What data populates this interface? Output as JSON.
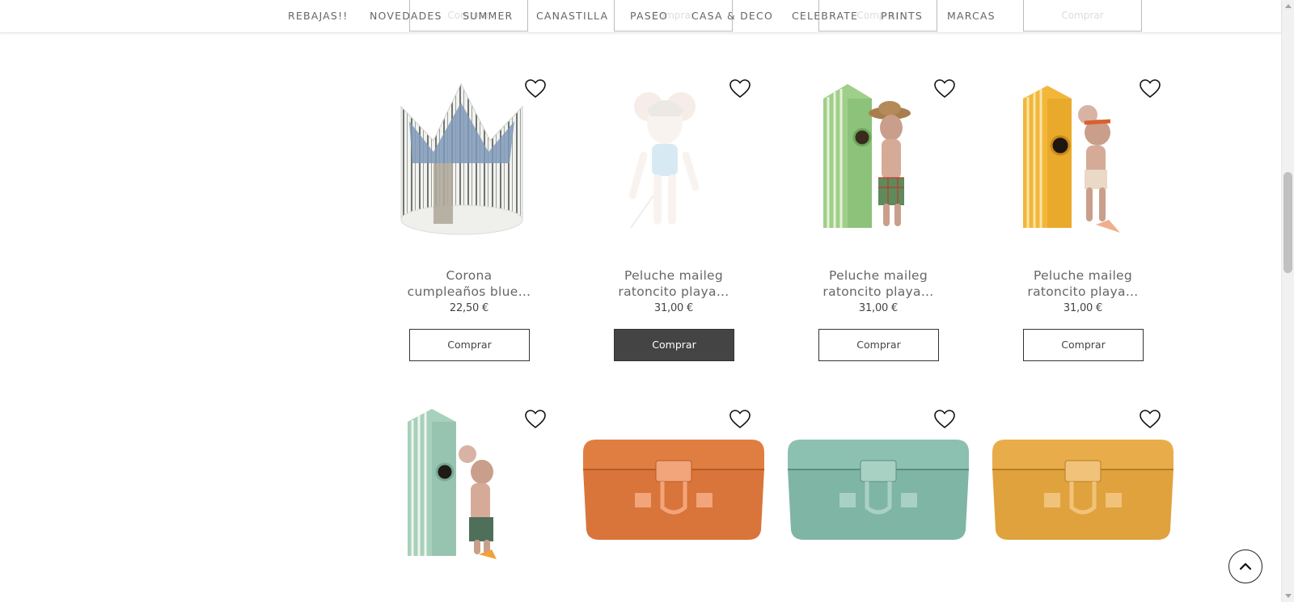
{
  "nav": {
    "items": [
      "REBAJAS!!",
      "NOVEDADES",
      "SUMMER",
      "CANASTILLA",
      "PASEO",
      "CASA & DECO",
      "CELEBRATE",
      "PRINTS",
      "MARCAS"
    ],
    "ghost_buttons": [
      "Comprar",
      "Comprar",
      "Comprar",
      "Comprar"
    ]
  },
  "products_row1": [
    {
      "name_line1": "Corona",
      "name_line2": "cumpleaños blue…",
      "price": "22,50 €",
      "buy_label": "Comprar"
    },
    {
      "name_line1": "Peluche maileg",
      "name_line2": "ratoncito playa…",
      "price": "31,00 €",
      "buy_label": "Comprar"
    },
    {
      "name_line1": "Peluche maileg",
      "name_line2": "ratoncito playa…",
      "price": "31,00 €",
      "buy_label": "Comprar"
    },
    {
      "name_line1": "Peluche maileg",
      "name_line2": "ratoncito playa…",
      "price": "31,00 €",
      "buy_label": "Comprar"
    }
  ],
  "colors": {
    "buy_hover_bg": "#444444",
    "suitcase_orange": "#d9743a",
    "suitcase_mint": "#7fb5a4",
    "suitcase_ochre": "#e0a23d",
    "hut_green": "#9fcf8a",
    "hut_yellow": "#f2b739",
    "hut_mint": "#a7d0bd"
  }
}
